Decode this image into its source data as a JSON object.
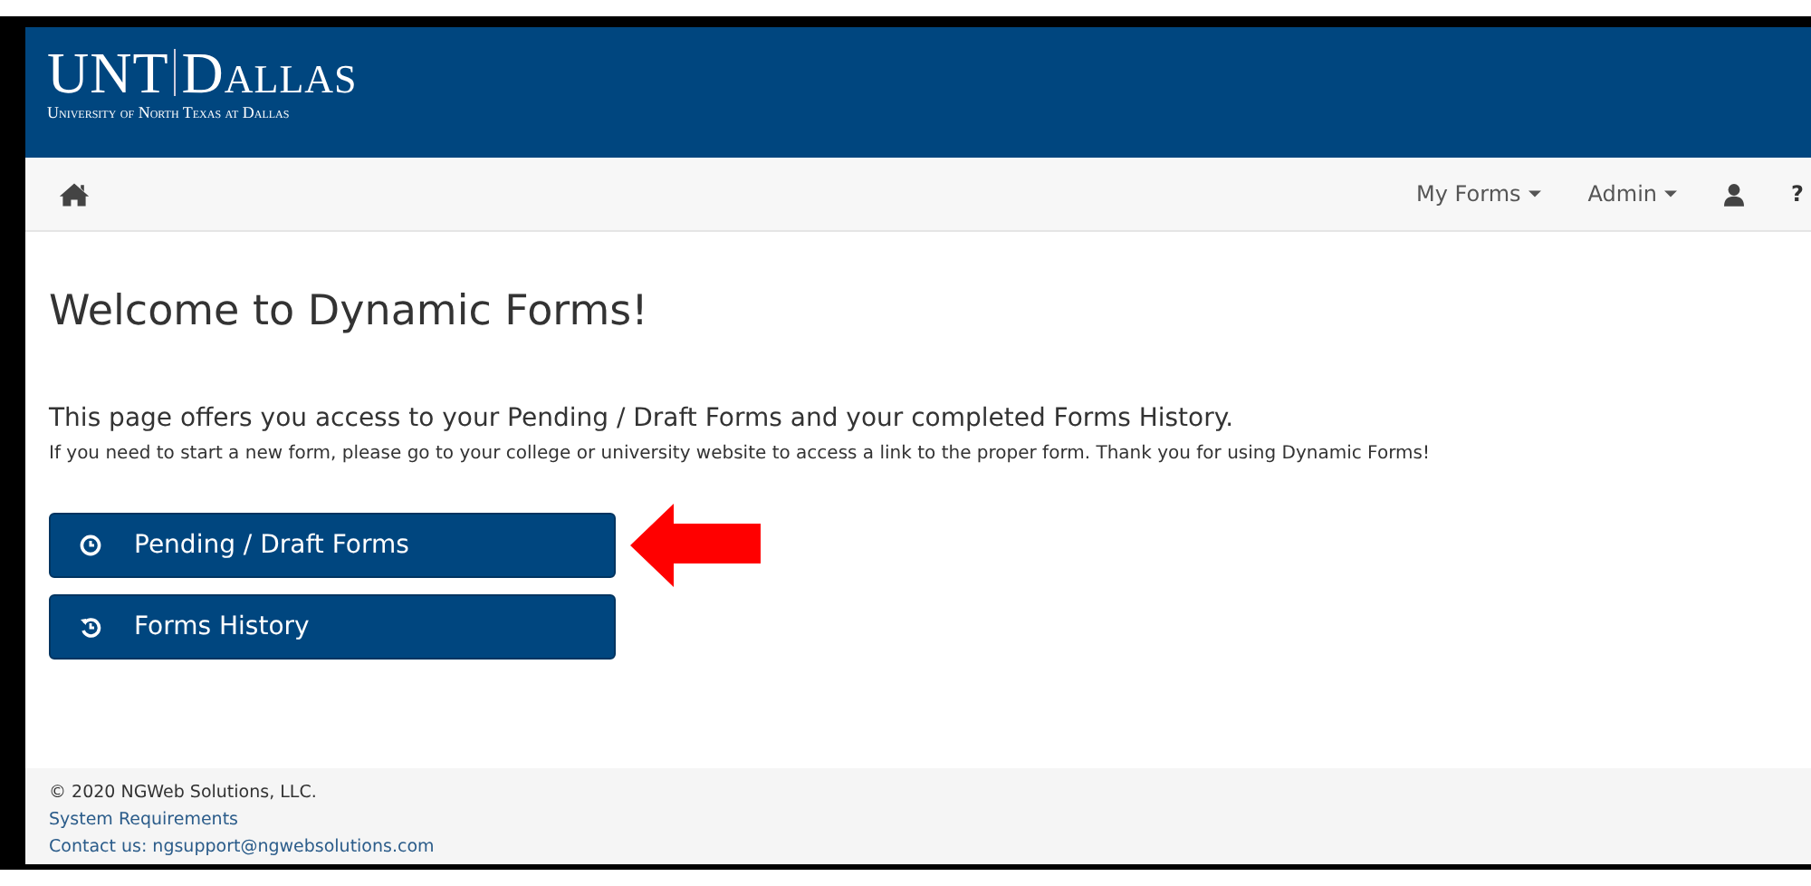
{
  "logo": {
    "left": "UNT",
    "right": "Dallas",
    "subtitle": "University of North Texas at Dallas"
  },
  "nav": {
    "items": [
      {
        "label": "My Forms",
        "kind": "dropdown"
      },
      {
        "label": "Admin",
        "kind": "dropdown"
      },
      {
        "kind": "user"
      },
      {
        "label": "?",
        "kind": "text"
      }
    ]
  },
  "title": "Welcome to Dynamic Forms!",
  "intro": "This page offers you access to your Pending / Draft Forms and your completed Forms History.",
  "note": "If you need to start a new form, please go to your college or university website to access a link to the proper form. Thank you for using Dynamic Forms!",
  "buttons": [
    {
      "label": "Pending / Draft Forms",
      "kind": "clock",
      "highlighted": true
    },
    {
      "label": "Forms History",
      "kind": "history",
      "highlighted": false
    }
  ],
  "footer": {
    "copyright": "© 2020 NGWeb Solutions, LLC.",
    "link": "System Requirements",
    "contact": "Contact us: ngsupport@ngwebsolutions.com"
  }
}
